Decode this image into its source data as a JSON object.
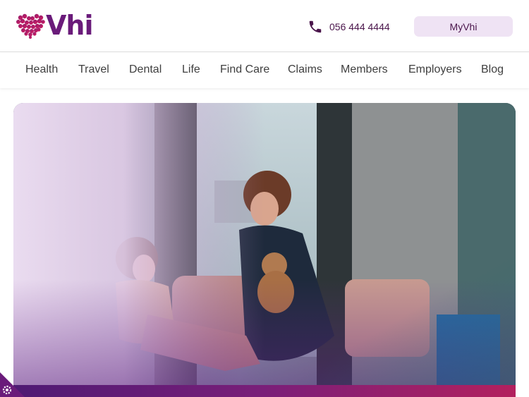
{
  "header": {
    "logo_text": "Vhi",
    "phone_number": "056 444 4444",
    "myvhi_label": "MyVhi"
  },
  "nav": {
    "items": [
      {
        "label": "Health"
      },
      {
        "label": "Travel"
      },
      {
        "label": "Dental"
      },
      {
        "label": "Life"
      },
      {
        "label": "Find Care"
      },
      {
        "label": "Claims"
      },
      {
        "label": "Members"
      },
      {
        "label": "Employers"
      },
      {
        "label": "Blog"
      }
    ]
  },
  "hero": {
    "image_icon": "hero-photo-nurse-with-child"
  },
  "cookie": {
    "icon": "gear-icon"
  },
  "colors": {
    "brand_purple": "#6a1b7a",
    "heart_pink": "#c2185b",
    "button_bg": "#efe3f4",
    "bar_start": "#4e1a73",
    "bar_end": "#b3205e"
  }
}
